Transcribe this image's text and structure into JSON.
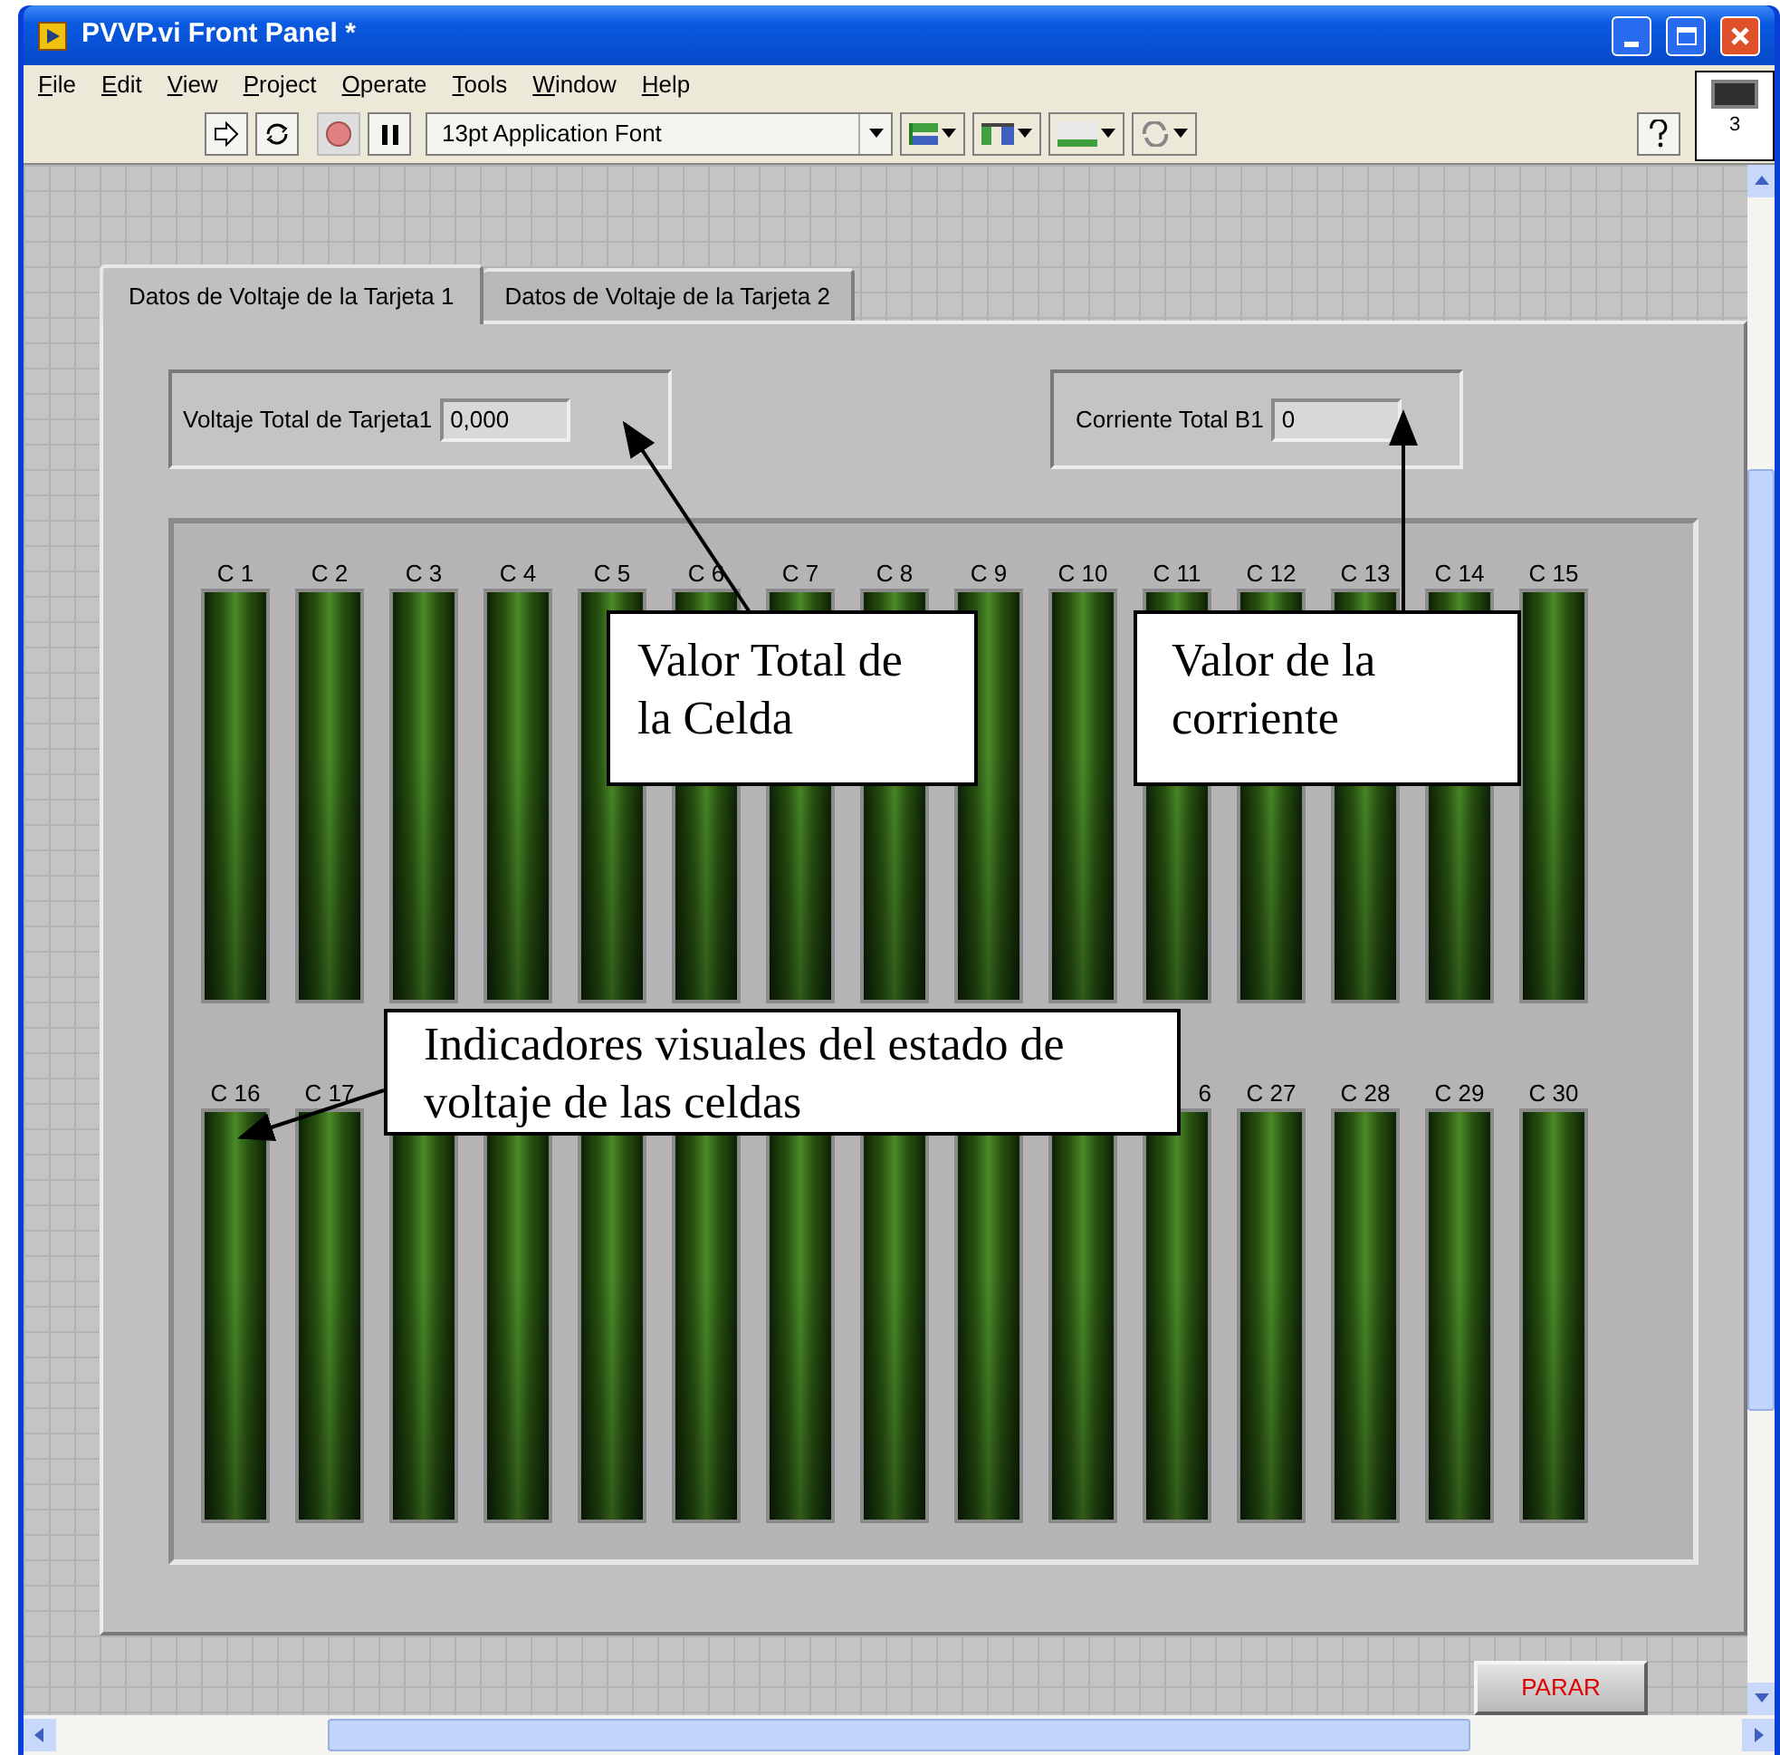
{
  "window": {
    "title": "PVVP.vi Front Panel *"
  },
  "menu": [
    {
      "label": "File"
    },
    {
      "label": "Edit"
    },
    {
      "label": "View"
    },
    {
      "label": "Project"
    },
    {
      "label": "Operate"
    },
    {
      "label": "Tools"
    },
    {
      "label": "Window"
    },
    {
      "label": "Help"
    }
  ],
  "toolbar": {
    "font": "13pt Application Font",
    "vi_icon_label": "3"
  },
  "tabs": [
    {
      "label": "Datos de Voltaje de la Tarjeta 1",
      "selected": true
    },
    {
      "label": "Datos de Voltaje de la Tarjeta 2",
      "selected": false
    }
  ],
  "indicators": [
    {
      "label": "Voltaje Total de Tarjeta1",
      "value": "0,000"
    },
    {
      "label": "Corriente Total B1",
      "value": "0"
    }
  ],
  "cell_rows": [
    {
      "labels_start": [
        "C 1",
        "C 2",
        "C 3",
        "C 4",
        "C 5",
        "C 6",
        "C 7",
        "C 8",
        "C 9",
        "C 10",
        "C 11",
        "C 12",
        "C 13",
        "C 14",
        "C 15"
      ]
    },
    {
      "labels_start": [
        "C 16",
        "C 17"
      ],
      "labels_end": [
        "6",
        "C 27",
        "C 28",
        "C 29",
        "C 30"
      ]
    }
  ],
  "callouts": [
    {
      "text": "Valor Total de la Celda"
    },
    {
      "text": "Valor de la corriente"
    },
    {
      "text": "Indicadores visuales del estado de voltaje de las celdas"
    }
  ],
  "stop_button": {
    "label": "PARAR"
  }
}
